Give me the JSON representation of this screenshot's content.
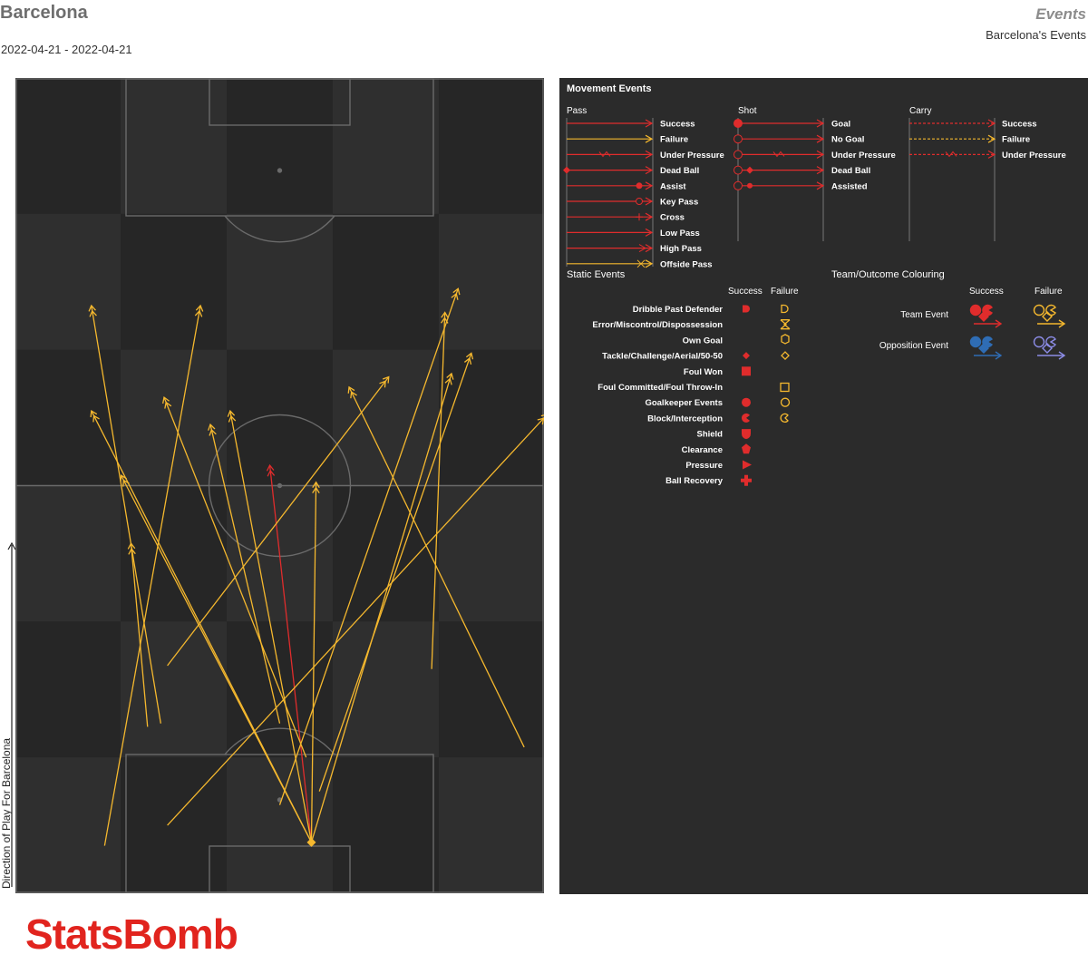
{
  "header": {
    "team": "Barcelona",
    "date_range": "2022-04-21 - 2022-04-21",
    "events_title": "Events",
    "events_subtitle": "Barcelona's Events"
  },
  "direction_label": "Direction of Play For Barcelona",
  "brand": "StatsBomb",
  "colors": {
    "team": "#e02c2c",
    "team_failure": "#f5b82e",
    "opposition": "#2f6db5",
    "opposition_failure": "#8c8ce6",
    "pitch_dark": "#262626",
    "pitch_light": "#2f2f2f",
    "legend_bg": "#2b2b2b"
  },
  "legend": {
    "movement_title": "Movement Events",
    "pass": {
      "title": "Pass",
      "items": [
        "Success",
        "Failure",
        "Under Pressure",
        "Dead Ball",
        "Assist",
        "Key Pass",
        "Cross",
        "Low Pass",
        "High Pass",
        "Offside Pass"
      ]
    },
    "shot": {
      "title": "Shot",
      "items": [
        "Goal",
        "No Goal",
        "Under Pressure",
        "Dead Ball",
        "Assisted"
      ]
    },
    "carry": {
      "title": "Carry",
      "items": [
        "Success",
        "Failure",
        "Under Pressure"
      ]
    },
    "static_title": "Static Events",
    "static_success": "Success",
    "static_failure": "Failure",
    "static_items": [
      "Dribble Past Defender",
      "Error/Miscontrol/Dispossession",
      "Own Goal",
      "Tackle/Challenge/Aerial/50-50",
      "Foul Won",
      "Foul Committed/Foul Throw-In",
      "Goalkeeper Events",
      "Block/Interception",
      "Shield",
      "Clearance",
      "Pressure",
      "Ball Recovery"
    ],
    "colouring_title": "Team/Outcome Colouring",
    "colouring_success": "Success",
    "colouring_failure": "Failure",
    "team_event": "Team Event",
    "opposition_event": "Opposition Event"
  },
  "chart_data": {
    "type": "scatter",
    "description_units": "pitch coordinates: x across width 0-80, y along length 0-120 (attacking upward)",
    "xlim": [
      0,
      80
    ],
    "ylim": [
      0,
      120
    ],
    "passes": [
      {
        "start": [
          44.8,
          7.5
        ],
        "end": [
          38.5,
          63.0
        ],
        "outcome": "success"
      },
      {
        "start": [
          44.8,
          7.5
        ],
        "end": [
          11.5,
          71.0
        ],
        "outcome": "failure"
      },
      {
        "start": [
          44.8,
          7.5
        ],
        "end": [
          16.0,
          61.5
        ],
        "outcome": "failure"
      },
      {
        "start": [
          44.8,
          7.5
        ],
        "end": [
          32.5,
          71.0
        ],
        "outcome": "failure"
      },
      {
        "start": [
          44.8,
          7.5
        ],
        "end": [
          66.0,
          76.5
        ],
        "outcome": "failure"
      },
      {
        "start": [
          44.8,
          7.5
        ],
        "end": [
          45.5,
          60.5
        ],
        "outcome": "failure"
      },
      {
        "start": [
          46.0,
          15.0
        ],
        "end": [
          69.0,
          79.5
        ],
        "outcome": "failure"
      },
      {
        "start": [
          13.5,
          7.0
        ],
        "end": [
          28.0,
          86.5
        ],
        "outcome": "failure"
      },
      {
        "start": [
          20.0,
          24.5
        ],
        "end": [
          17.5,
          51.5
        ],
        "outcome": "failure"
      },
      {
        "start": [
          22.0,
          25.0
        ],
        "end": [
          11.5,
          86.5
        ],
        "outcome": "failure"
      },
      {
        "start": [
          44.0,
          20.0
        ],
        "end": [
          22.5,
          73.0
        ],
        "outcome": "failure"
      },
      {
        "start": [
          40.0,
          13.0
        ],
        "end": [
          67.0,
          89.0
        ],
        "outcome": "failure"
      },
      {
        "start": [
          63.0,
          33.0
        ],
        "end": [
          65.0,
          85.5
        ],
        "outcome": "failure"
      },
      {
        "start": [
          77.0,
          21.5
        ],
        "end": [
          50.5,
          74.5
        ],
        "outcome": "failure"
      },
      {
        "start": [
          23.0,
          10.0
        ],
        "end": [
          80.5,
          70.5
        ],
        "outcome": "failure"
      },
      {
        "start": [
          23.0,
          33.5
        ],
        "end": [
          56.5,
          76.0
        ],
        "outcome": "failure"
      },
      {
        "start": [
          40.0,
          25.0
        ],
        "end": [
          29.5,
          69.0
        ],
        "outcome": "failure"
      }
    ],
    "static_events": [
      {
        "type": "pass-origin",
        "x": 44.8,
        "y": 7.5,
        "outcome": "failure"
      }
    ]
  }
}
